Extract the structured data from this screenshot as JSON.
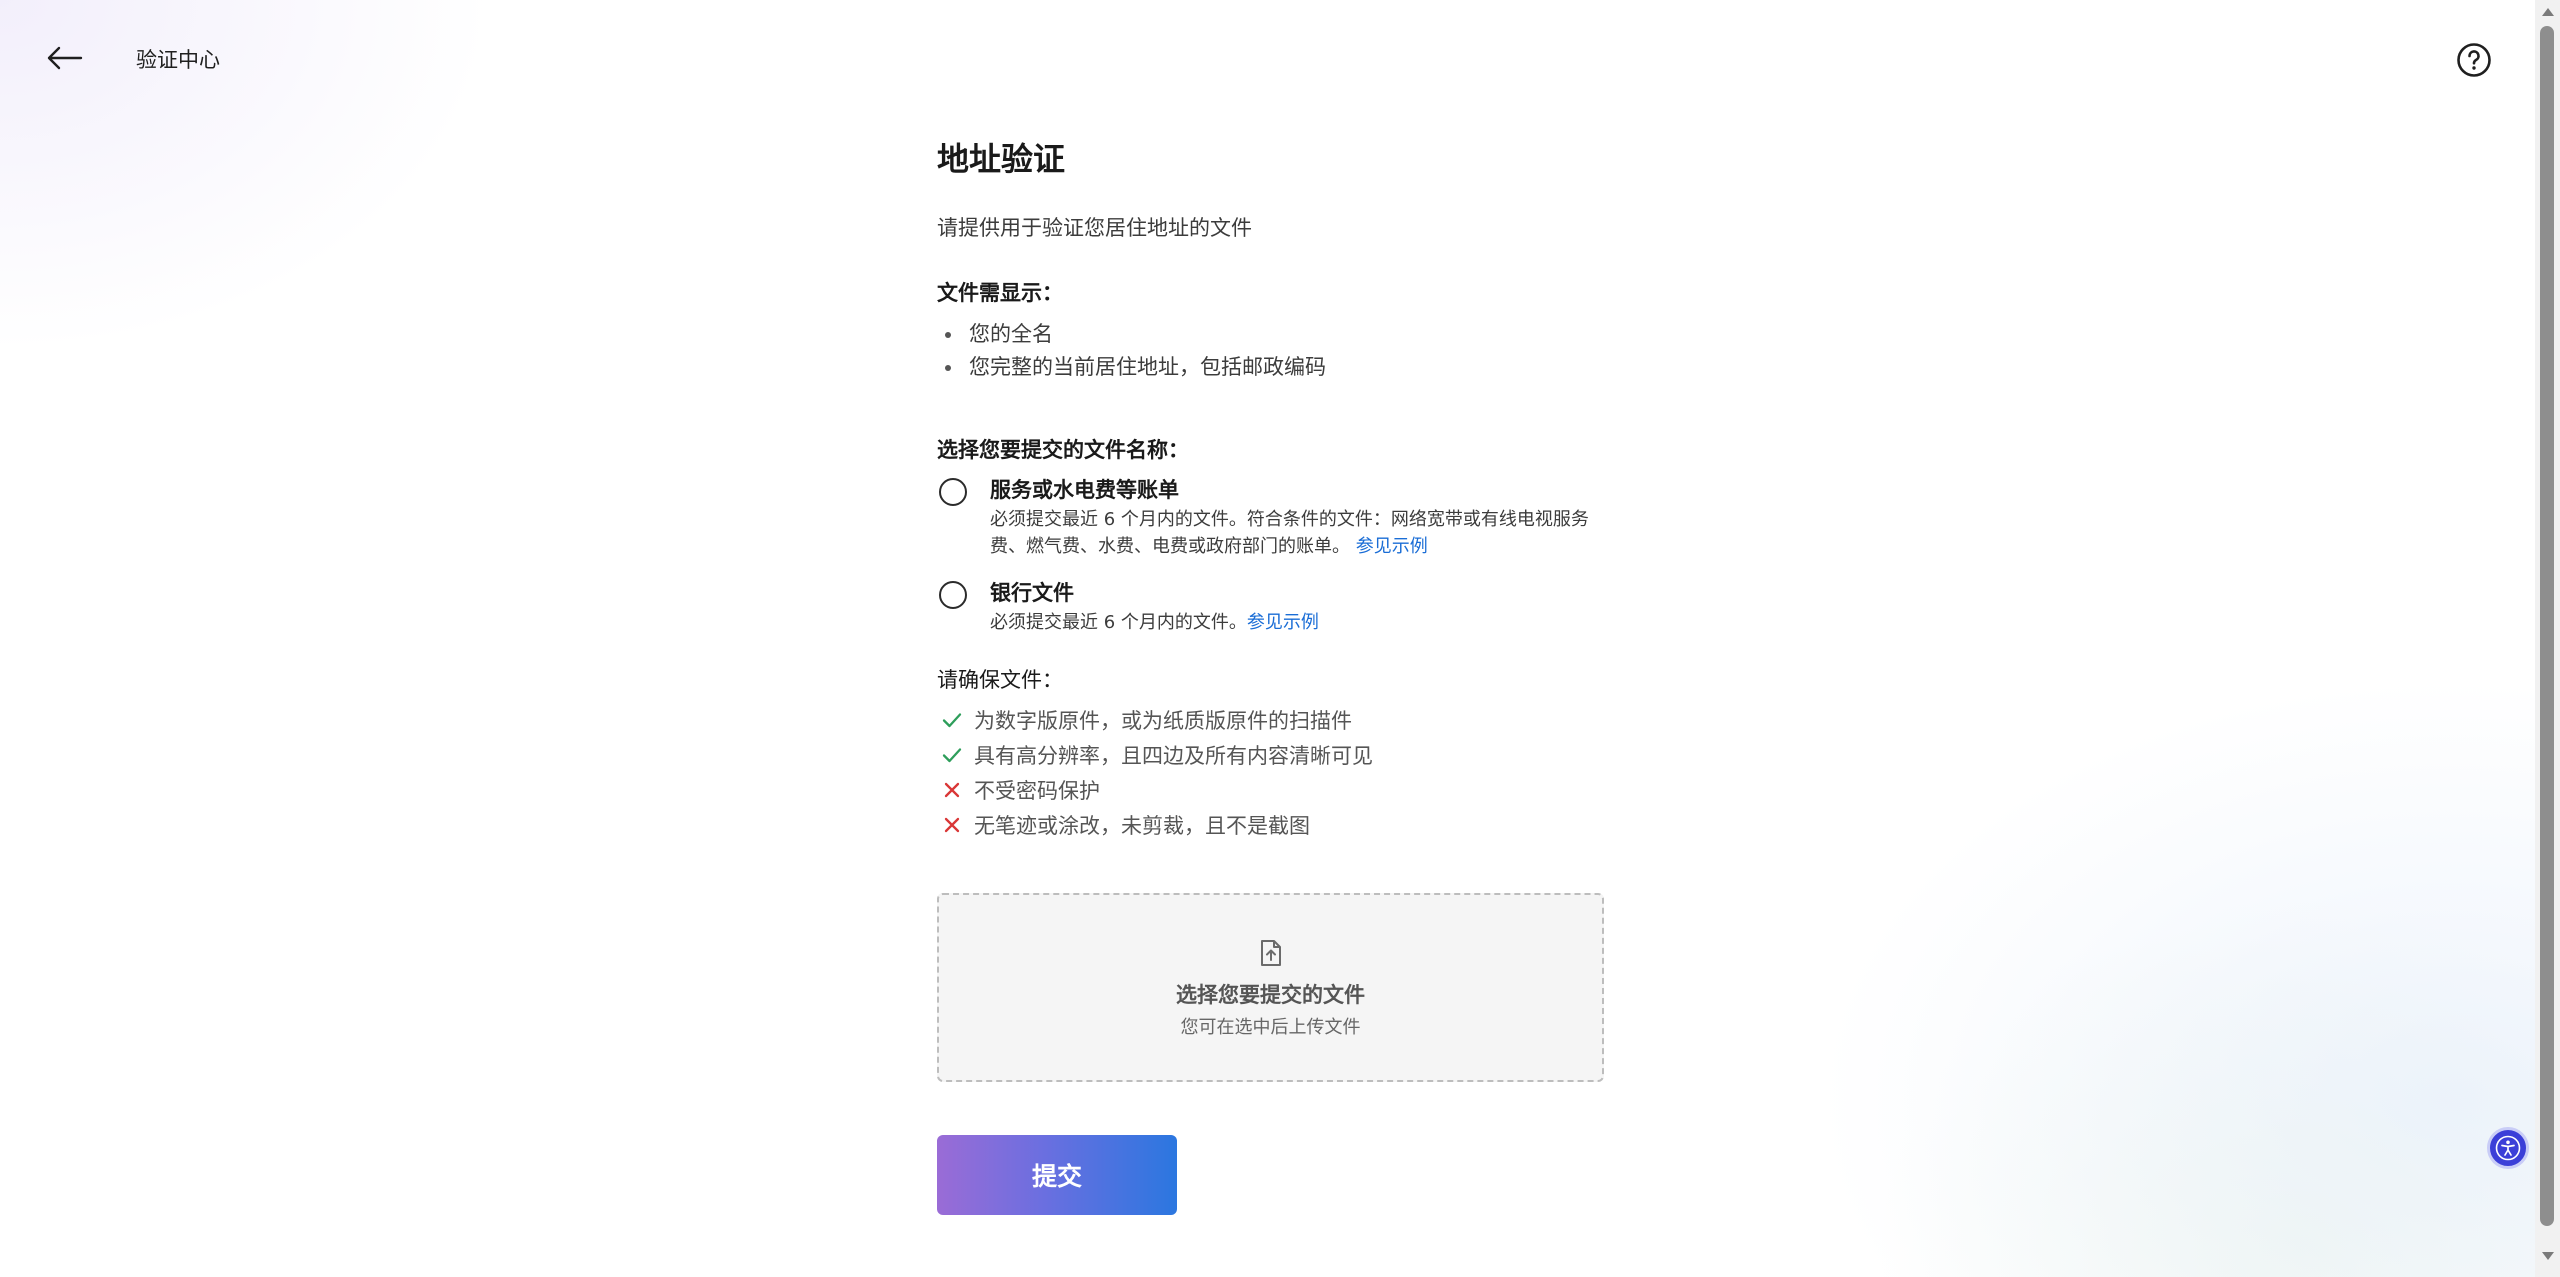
{
  "header": {
    "title": "验证中心",
    "back_icon": "arrow-left-icon",
    "help_icon": "question-circle-icon"
  },
  "main": {
    "title": "地址验证",
    "intro": "请提供用于验证您居住地址的文件",
    "requirements_heading": "文件需显示：",
    "requirements": [
      "您的全名",
      "您完整的当前居住地址，包括邮政编码"
    ],
    "choose_heading": "选择您要提交的文件名称：",
    "options": [
      {
        "title": "服务或水电费等账单",
        "description": "必须提交最近 6 个月内的文件。符合条件的文件：网络宽带或有线电视服务费、燃气费、水费、电费或政府部门的账单。",
        "link": "参见示例",
        "selected": false
      },
      {
        "title": "银行文件",
        "description": "必须提交最近 6 个月内的文件。",
        "link": "参见示例",
        "selected": false
      }
    ],
    "ensure_heading": "请确保文件：",
    "checks": [
      {
        "text": "为数字版原件，或为纸质版原件的扫描件",
        "status": "ok"
      },
      {
        "text": "具有高分辨率，且四边及所有内容清晰可见",
        "status": "ok"
      },
      {
        "text": "不受密码保护",
        "status": "no"
      },
      {
        "text": "无笔迹或涂改，未剪裁，且不是截图",
        "status": "no"
      }
    ],
    "upload": {
      "icon": "file-upload-icon",
      "title": "选择您要提交的文件",
      "subtitle": "您可在选中后上传文件"
    },
    "submit_label": "提交"
  },
  "colors": {
    "link": "#1a6dd6",
    "check_ok": "#2e9e5b",
    "check_no": "#d93636",
    "submit_gradient": [
      "#9a6cd6",
      "#2b77e0"
    ],
    "accessibility_button": "#3b3fd8"
  },
  "accessibility_icon": "accessibility-icon"
}
